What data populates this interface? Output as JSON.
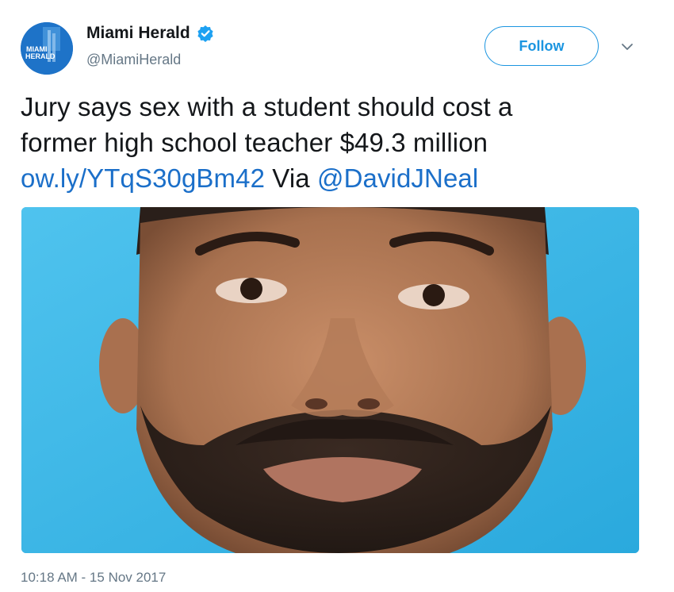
{
  "author": {
    "display_name": "Miami Herald",
    "handle": "@MiamiHerald",
    "avatar_text_line1": "MIAMI",
    "avatar_text_line2": "HERALD",
    "verified": true
  },
  "actions": {
    "follow_label": "Follow",
    "menu_icon": "chevron-down-icon"
  },
  "tweet": {
    "text_line1": "Jury says sex with a student should cost a",
    "text_line2": "former high school teacher $49.3 million",
    "link_text": "ow.ly/YTqS30gBm42",
    "via_text": " Via ",
    "mention_text": "@DavidJNeal",
    "timestamp": "10:18 AM - 15 Nov 2017"
  },
  "media": {
    "description_icon": "photo-icon",
    "background_color": "#3db8e8"
  },
  "colors": {
    "link": "#1b6fc9",
    "follow": "#1b95e0",
    "muted": "#657786",
    "text": "#14171a"
  }
}
